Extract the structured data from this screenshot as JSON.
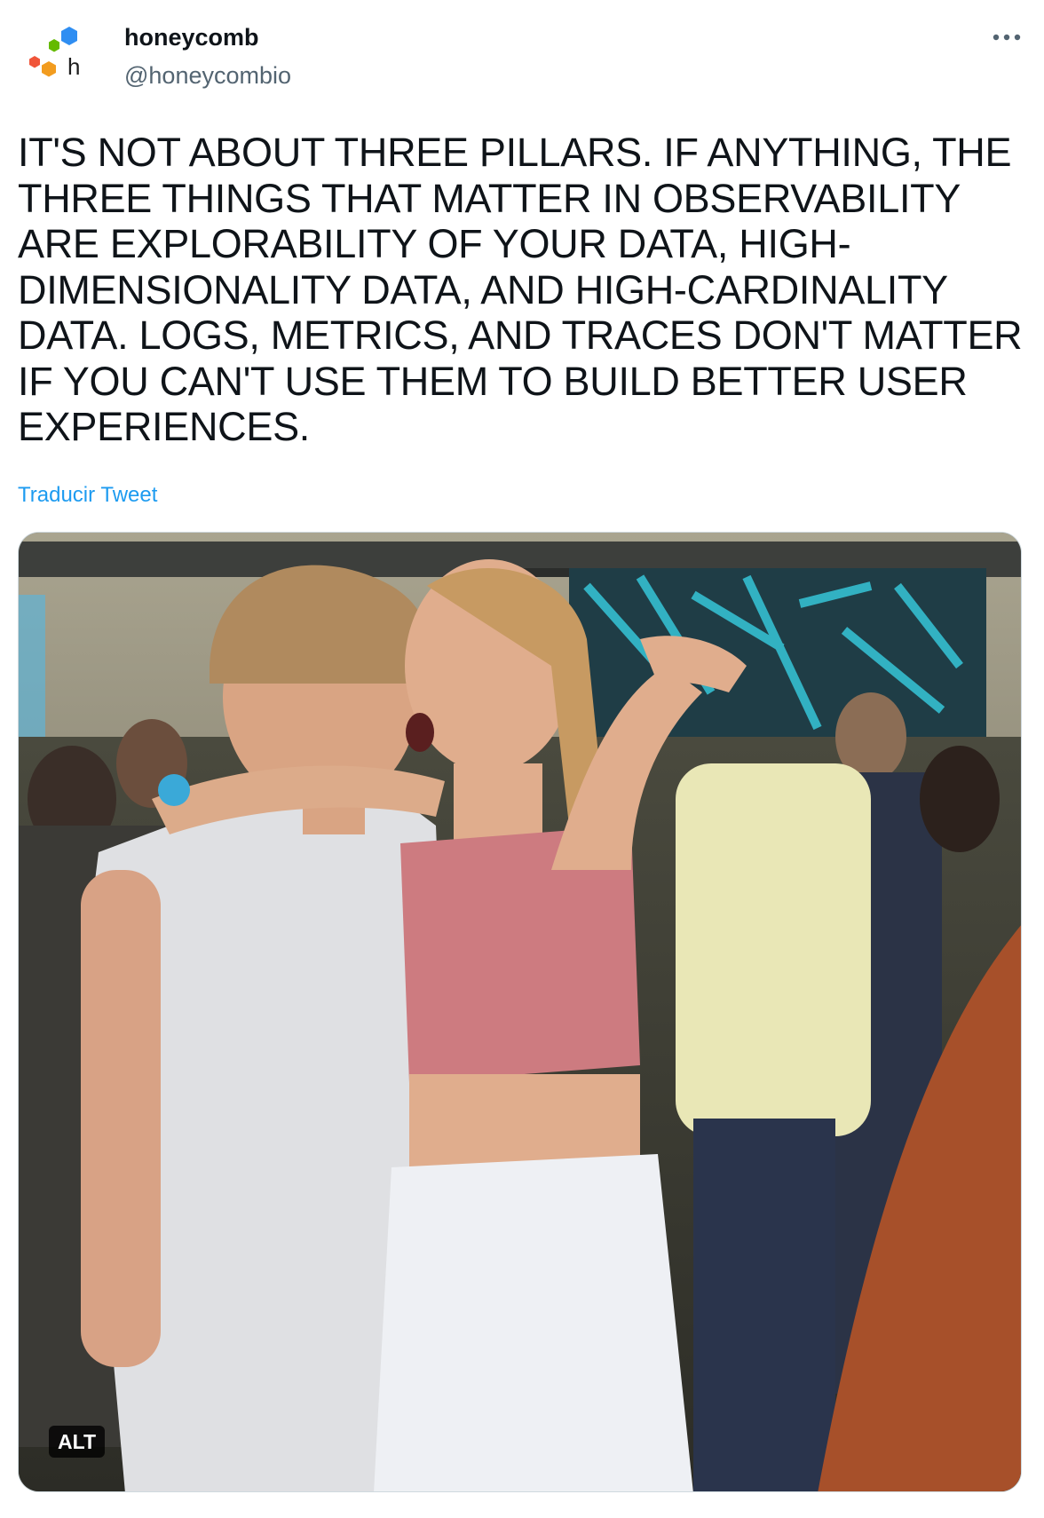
{
  "author": {
    "display_name": "honeycomb",
    "handle": "@honeycombio",
    "avatar_icon": "honeycomb-logo-icon"
  },
  "menu": {
    "more_icon": "more-horizontal-icon"
  },
  "tweet": {
    "text": "IT'S NOT ABOUT THREE PILLARS. IF ANYTHING, THE\nTHREE THINGS THAT MATTER IN OBSERVABILITY\nARE EXPLORABILITY OF YOUR DATA, HIGH-\nDIMENSIONALITY DATA, AND HIGH-CARDINALITY\nDATA. LOGS, METRICS, AND TRACES DON'T MATTER\nIF YOU CAN'T USE THEM TO BUILD BETTER USER\nEXPERIENCES.",
    "translate_label": "Traducir Tweet"
  },
  "media": {
    "alt_label": "ALT"
  },
  "colors": {
    "link": "#1d9bf0",
    "secondary_text": "#536471",
    "logo_blue": "#2f8ef2",
    "logo_green": "#64ba00",
    "logo_orange": "#f29c1f",
    "logo_red": "#f0553a"
  }
}
